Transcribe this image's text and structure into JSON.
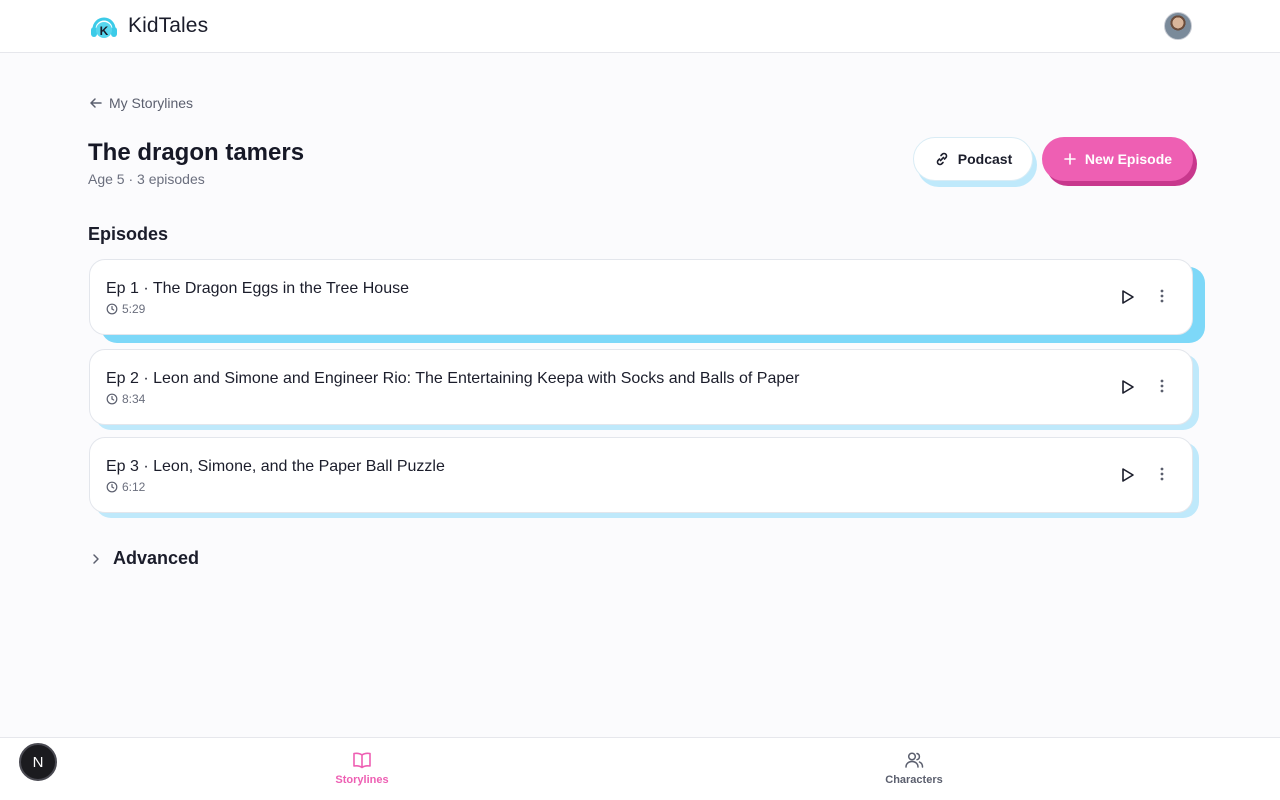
{
  "app": {
    "name": "KidTales"
  },
  "back_link": {
    "label": "My Storylines"
  },
  "storyline": {
    "title": "The dragon tamers",
    "meta": "Age 5 · 3 episodes"
  },
  "actions": {
    "podcast_label": "Podcast",
    "new_episode_label": "New Episode"
  },
  "episodes_section": {
    "title": "Episodes"
  },
  "episodes": [
    {
      "title": "Ep 1 · The Dragon Eggs in the Tree House",
      "duration": "5:29"
    },
    {
      "title": "Ep 2 · Leon and Simone and Engineer Rio: The Entertaining Keepa with Socks and Balls of Paper",
      "duration": "8:34"
    },
    {
      "title": "Ep 3 · Leon, Simone, and the Paper Ball Puzzle",
      "duration": "6:12"
    }
  ],
  "advanced": {
    "label": "Advanced"
  },
  "bottom_nav": {
    "items": [
      {
        "label": "Storylines",
        "icon": "book-open-icon",
        "active": true
      },
      {
        "label": "Characters",
        "icon": "users-icon",
        "active": false
      }
    ],
    "fab_letter": "N"
  },
  "colors": {
    "accent_pink": "#ee5fb3",
    "accent_blue": "#7dd8f8",
    "text": "#1b1d2b"
  }
}
